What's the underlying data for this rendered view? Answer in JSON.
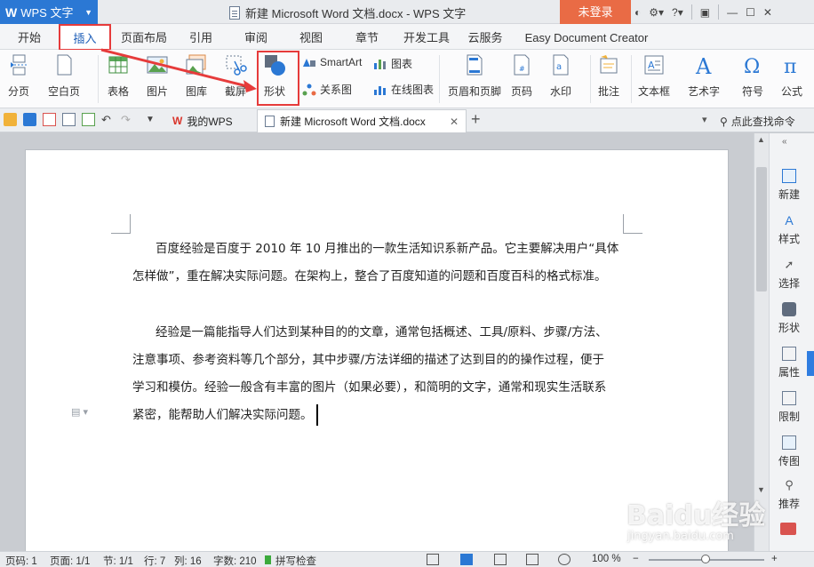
{
  "titlebar": {
    "app_name": "WPS 文字",
    "document_title": "新建 Microsoft Word 文档.docx - WPS 文字",
    "login_label": "未登录"
  },
  "menu_tabs": [
    "开始",
    "插入",
    "页面布局",
    "引用",
    "审阅",
    "视图",
    "章节",
    "开发工具",
    "云服务",
    "Easy Document Creator"
  ],
  "active_tab": "插入",
  "ribbon": {
    "page_break": "分页",
    "blank_page": "空白页",
    "table": "表格",
    "picture": "图片",
    "gallery": "图库",
    "screenshot": "截屏",
    "shapes": "形状",
    "smartart": "SmartArt",
    "chart": "图表",
    "relation_chart": "关系图",
    "online_chart": "在线图表",
    "header_footer": "页眉和页脚",
    "page_number": "页码",
    "watermark": "水印",
    "comment": "批注",
    "textbox": "文本框",
    "wordart": "艺术字",
    "symbol": "符号",
    "formula": "公式"
  },
  "doc_tabs": {
    "my_wps": "我的WPS",
    "current": "新建 Microsoft Word 文档.docx",
    "command_search": "点此查找命令"
  },
  "document": {
    "para1_line1": "百度经验是百度于 2010 年 10 月推出的一款生活知识系新产品。它主要解决用户“具体",
    "para1_line2": "怎样做”，重在解决实际问题。在架构上，整合了百度知道的问题和百度百科的格式标准。",
    "para2_line1": "经验是一篇能指导人们达到某种目的的文章，通常包括概述、工具/原料、步骤/方法、",
    "para2_line2": "注意事项、参考资料等几个部分，其中步骤/方法详细的描述了达到目的的操作过程，便于",
    "para2_line3": "学习和模仿。经验一般含有丰富的图片（如果必要），和简明的文字，通常和现实生活联系",
    "para2_line4": "紧密，能帮助人们解决实际问题。"
  },
  "side_panel": [
    "新建",
    "样式",
    "选择",
    "形状",
    "属性",
    "限制",
    "传图",
    "推荐"
  ],
  "statusbar": {
    "page_no": "页码: 1",
    "page": "页面: 1/1",
    "section": "节: 1/1",
    "row": "行: 7",
    "col": "列: 16",
    "word_count": "字数: 210",
    "spell_check": "拼写检查",
    "zoom": "100 %"
  },
  "watermark": {
    "brand": "Baidu经验",
    "url": "jingyan.baidu.com"
  },
  "colors": {
    "accent": "#2b78d4",
    "login": "#e96b45",
    "highlight_red": "#e63b3b"
  }
}
